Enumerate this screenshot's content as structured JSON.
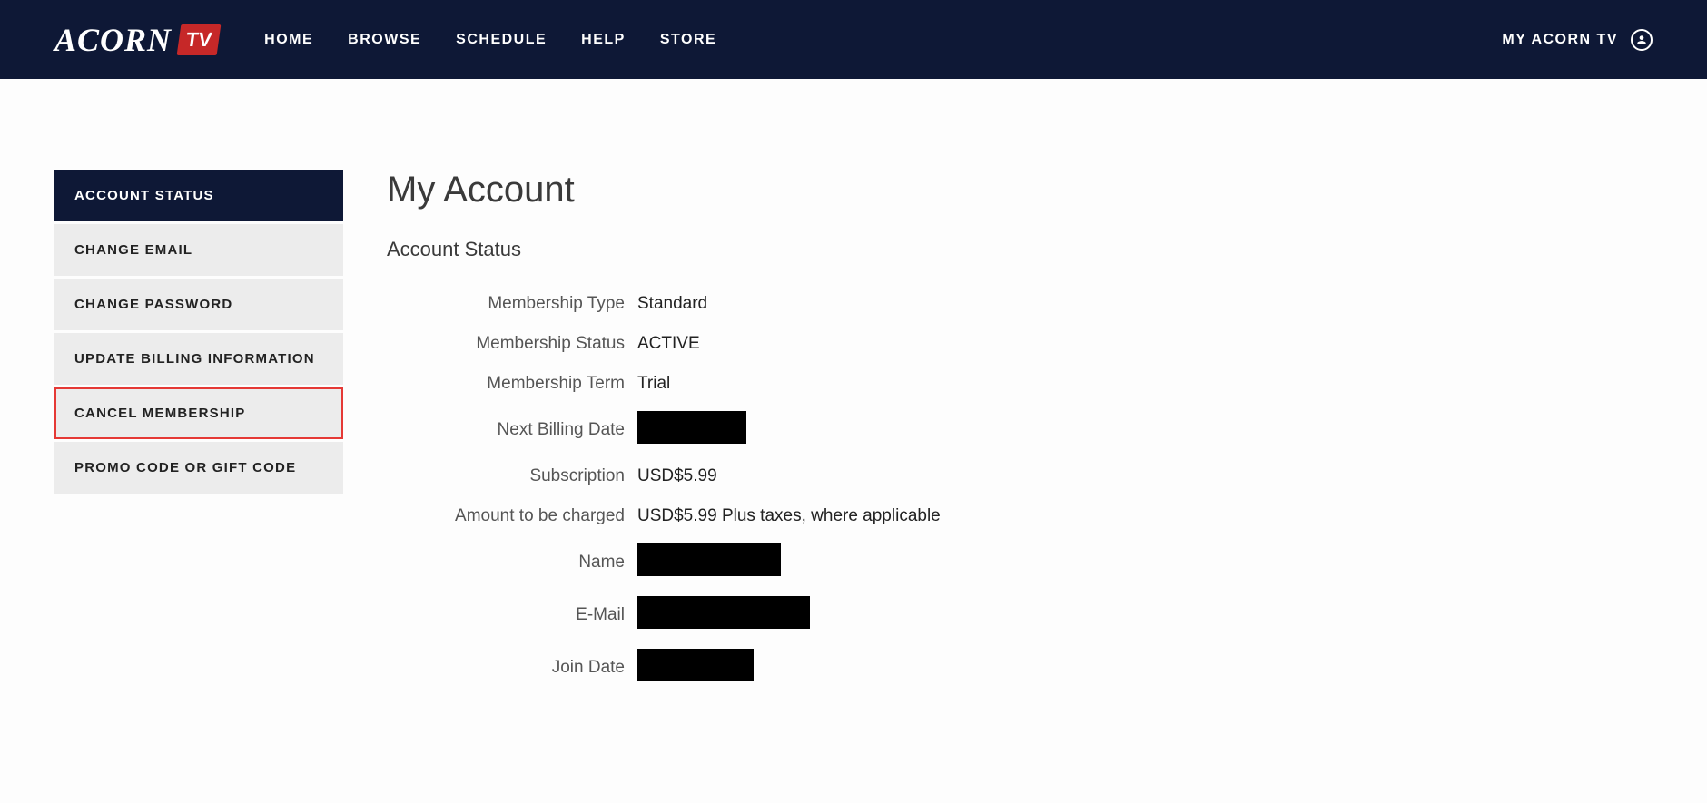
{
  "header": {
    "logo_text": "ACORN",
    "logo_tv": "TV",
    "nav": [
      {
        "label": "HOME"
      },
      {
        "label": "BROWSE"
      },
      {
        "label": "SCHEDULE"
      },
      {
        "label": "HELP"
      },
      {
        "label": "STORE"
      }
    ],
    "account_link": "MY ACORN TV"
  },
  "sidebar": {
    "items": [
      {
        "label": "ACCOUNT STATUS",
        "active": true
      },
      {
        "label": "CHANGE EMAIL"
      },
      {
        "label": "CHANGE PASSWORD"
      },
      {
        "label": "UPDATE BILLING INFORMATION"
      },
      {
        "label": "CANCEL MEMBERSHIP",
        "highlighted": true
      },
      {
        "label": "PROMO CODE OR GIFT CODE"
      }
    ]
  },
  "main": {
    "title": "My Account",
    "section_title": "Account Status",
    "fields": {
      "membership_type_label": "Membership Type",
      "membership_type_value": "Standard",
      "membership_status_label": "Membership Status",
      "membership_status_value": "ACTIVE",
      "membership_term_label": "Membership Term",
      "membership_term_value": "Trial",
      "next_billing_label": "Next Billing Date",
      "subscription_label": "Subscription",
      "subscription_value": "USD$5.99",
      "amount_label": "Amount to be charged",
      "amount_value": "USD$5.99 Plus taxes, where applicable",
      "name_label": "Name",
      "email_label": "E-Mail",
      "join_date_label": "Join Date"
    }
  }
}
